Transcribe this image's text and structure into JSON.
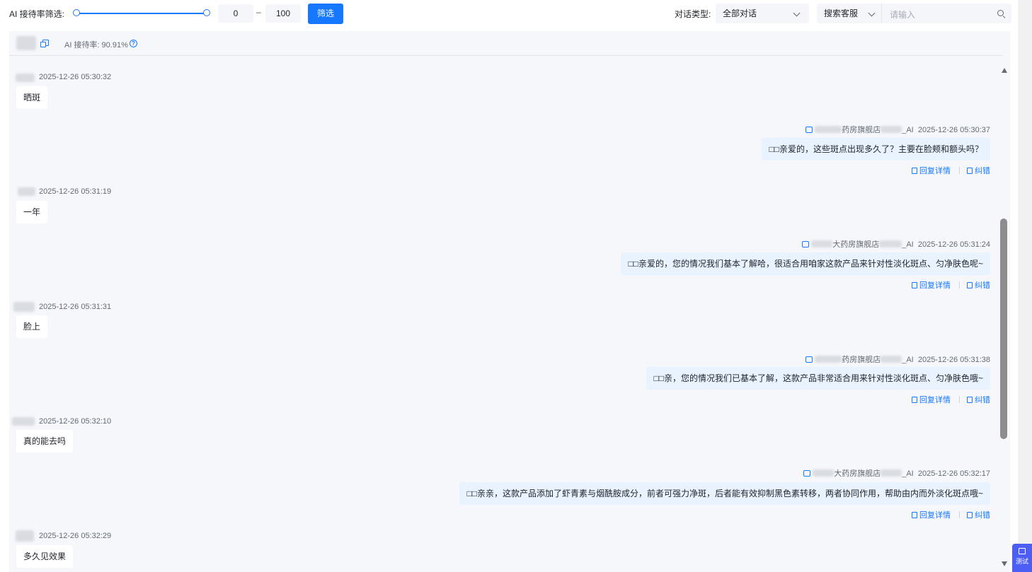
{
  "toolbar": {
    "filter_label": "AI 接待率筛选:",
    "range_min": "0",
    "range_dash": "–",
    "range_max": "100",
    "filter_button": "筛选",
    "type_label": "对话类型:",
    "type_selected": "全部对话",
    "search_scope": "搜索客服",
    "search_placeholder": "请输入"
  },
  "header": {
    "ai_rate": "AI 接待率:  90.91%",
    "help_glyph": "?"
  },
  "messages": [
    {
      "side": "customer",
      "time": "2025-12-26 05:30:32",
      "text": "晒斑"
    },
    {
      "side": "agent",
      "shop": "药房旗舰店",
      "suffix": "_AI",
      "time": "2025-12-26 05:30:37",
      "text": "亲爱的，这些斑点出现多久了？主要在脸颊和额头吗？"
    },
    {
      "side": "customer",
      "time": "2025-12-26 05:31:19",
      "text": "一年"
    },
    {
      "side": "agent",
      "shop": "大药房旗舰店",
      "suffix": "_AI",
      "time": "2025-12-26 05:31:24",
      "text": "亲爱的，您的情况我们基本了解哈，很适合用咱家这款产品来针对性淡化斑点、匀净肤色呢~"
    },
    {
      "side": "customer",
      "time": "2025-12-26 05:31:31",
      "text": "脸上"
    },
    {
      "side": "agent",
      "shop": "药房旗舰店",
      "suffix": "_AI",
      "time": "2025-12-26 05:31:38",
      "text": "亲，您的情况我们已基本了解，这款产品非常适合用来针对性淡化斑点、匀净肤色哦~"
    },
    {
      "side": "customer",
      "time": "2025-12-26 05:32:10",
      "text": "真的能去吗"
    },
    {
      "side": "agent",
      "shop": "大药房旗舰店",
      "suffix": "_AI",
      "time": "2025-12-26 05:32:17",
      "text": "亲亲，这款产品添加了虾青素与烟酰胺成分，前者可强力净斑，后者能有效抑制黑色素转移，两者协同作用，帮助由内而外淡化斑点哦~"
    },
    {
      "side": "customer",
      "time": "2025-12-26 05:32:29",
      "text": "多久见效果"
    }
  ],
  "actions": {
    "reply_detail": "回复详情",
    "correct": "纠错"
  },
  "test_button": "测试"
}
